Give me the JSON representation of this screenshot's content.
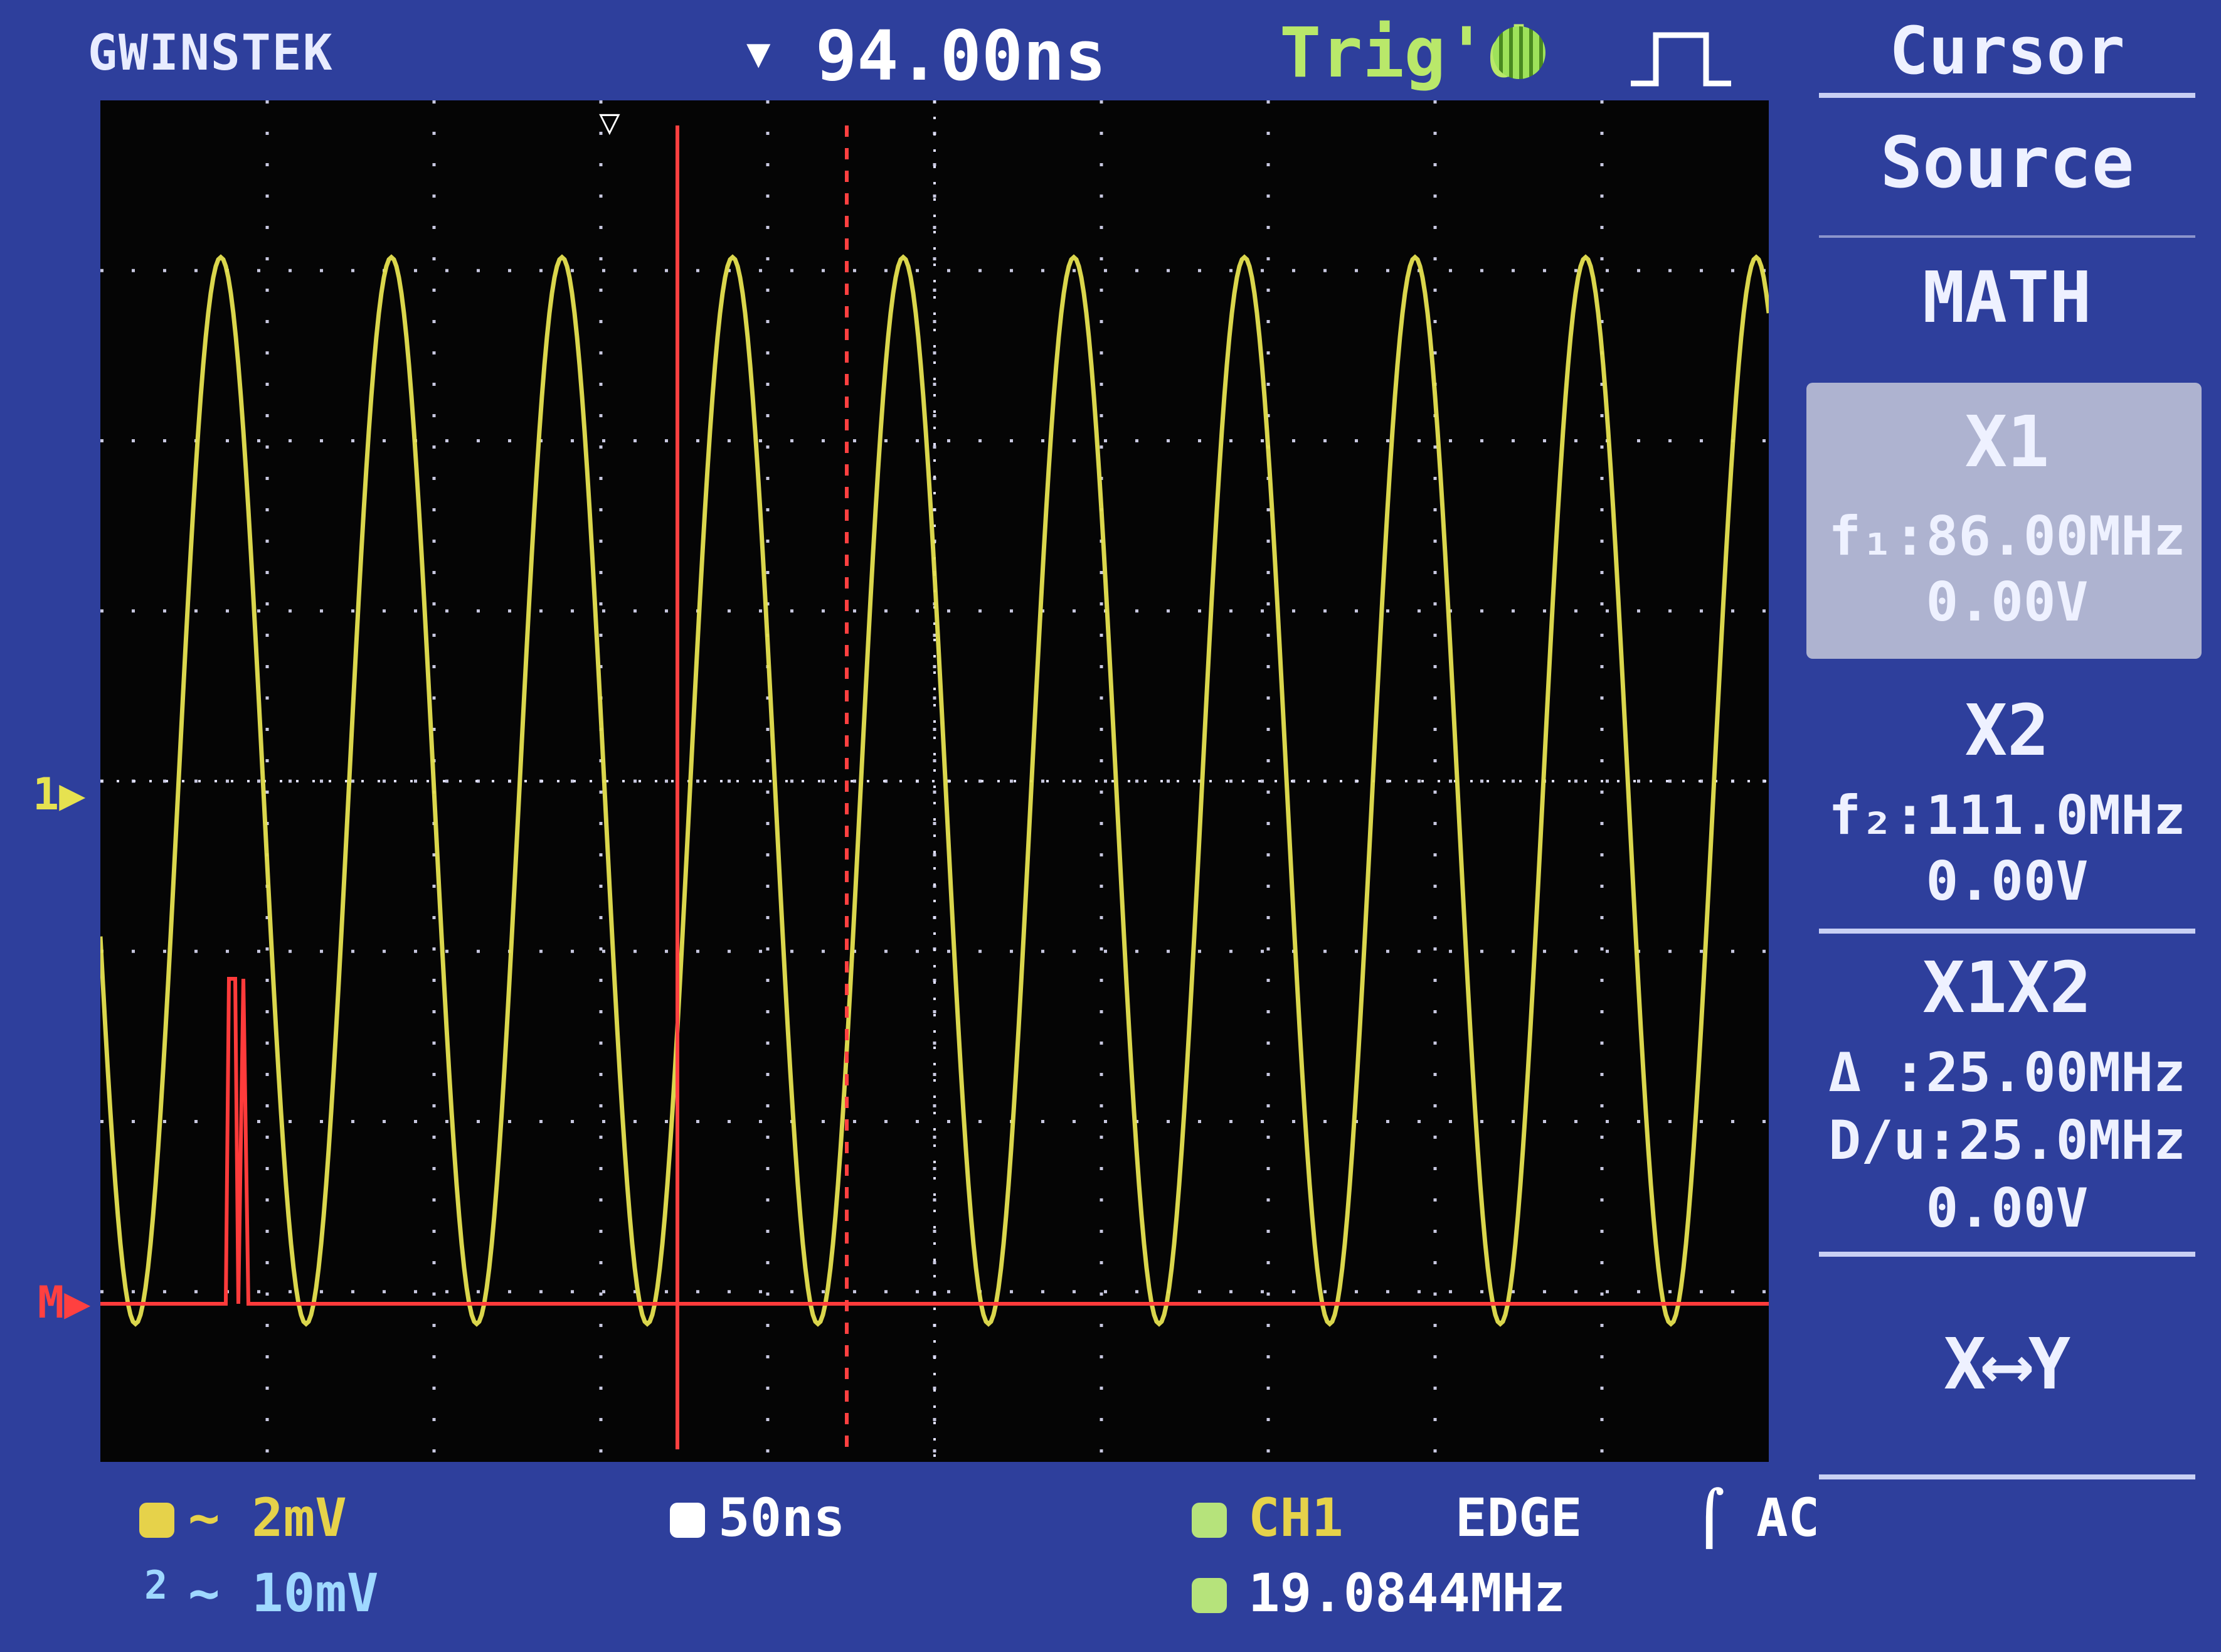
{
  "header": {
    "brand": "GWINSTEK",
    "horizontal_position": "94.00ns",
    "trigger_status": "Trig'd"
  },
  "menu": {
    "title": "Cursor",
    "source_label": "Source",
    "source_value": "MATH",
    "x1": {
      "title": "X1",
      "freq": "f₁:86.00MHz",
      "volt": "0.00V"
    },
    "x2": {
      "title": "X2",
      "freq": "f₂:111.0MHz",
      "volt": "0.00V"
    },
    "x1x2": {
      "title": "X1X2",
      "delta": "Δ :25.00MHz",
      "div": "D/u:25.0MHz",
      "volt": "0.00V"
    },
    "swap": "X⟷Y"
  },
  "markers": {
    "ch1": "1",
    "math": "M"
  },
  "bottom": {
    "ch1_scale": "∼ 2mV",
    "ch2_scale": "∼ 10mV",
    "timebase": "50ns",
    "trigger_source": "CH1",
    "trigger_type": "EDGE",
    "trigger_coupling": "AC",
    "frequency": "19.0844MHz"
  },
  "colors": {
    "ch1_trace": "#e6e250",
    "math_trace": "#ff3b3b",
    "cursor": "#ff4040",
    "background": "#2e3f9c"
  }
}
